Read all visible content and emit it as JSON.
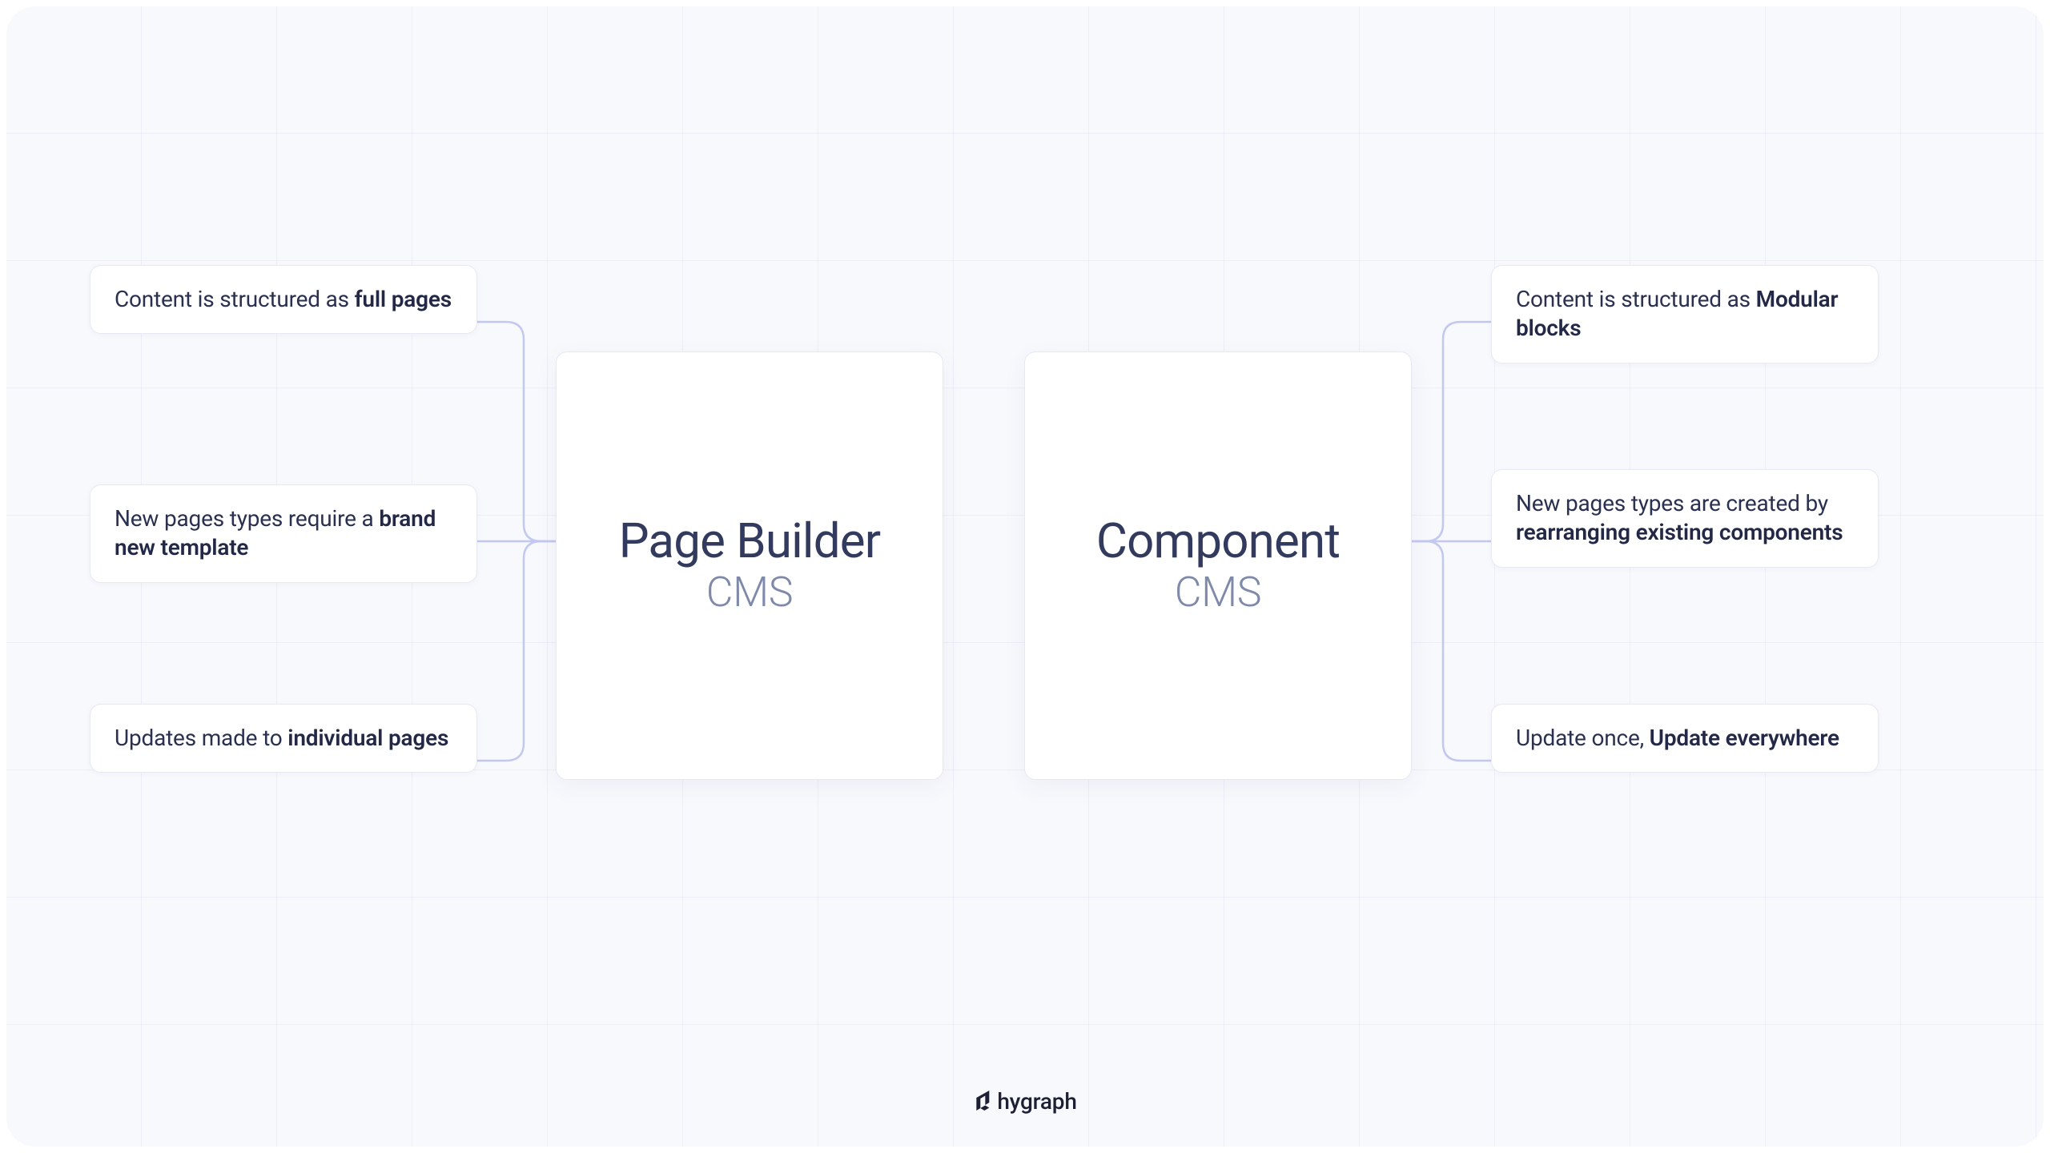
{
  "left": {
    "items": [
      {
        "text": "Content is structured as ",
        "bold": "full pages"
      },
      {
        "text": "New pages types require a ",
        "bold": "brand new template"
      },
      {
        "text": "Updates made to ",
        "bold": "individual pages"
      }
    ]
  },
  "center_left": {
    "title": "Page Builder",
    "sub": "CMS"
  },
  "center_right": {
    "title": "Component",
    "sub": "CMS"
  },
  "right": {
    "items": [
      {
        "text": "Content is structured as ",
        "bold": "Modular blocks"
      },
      {
        "text": "New pages types are created by ",
        "bold": "rearranging existing components"
      },
      {
        "text": "Update once, ",
        "bold": "Update everywhere"
      }
    ]
  },
  "brand": "hygraph"
}
